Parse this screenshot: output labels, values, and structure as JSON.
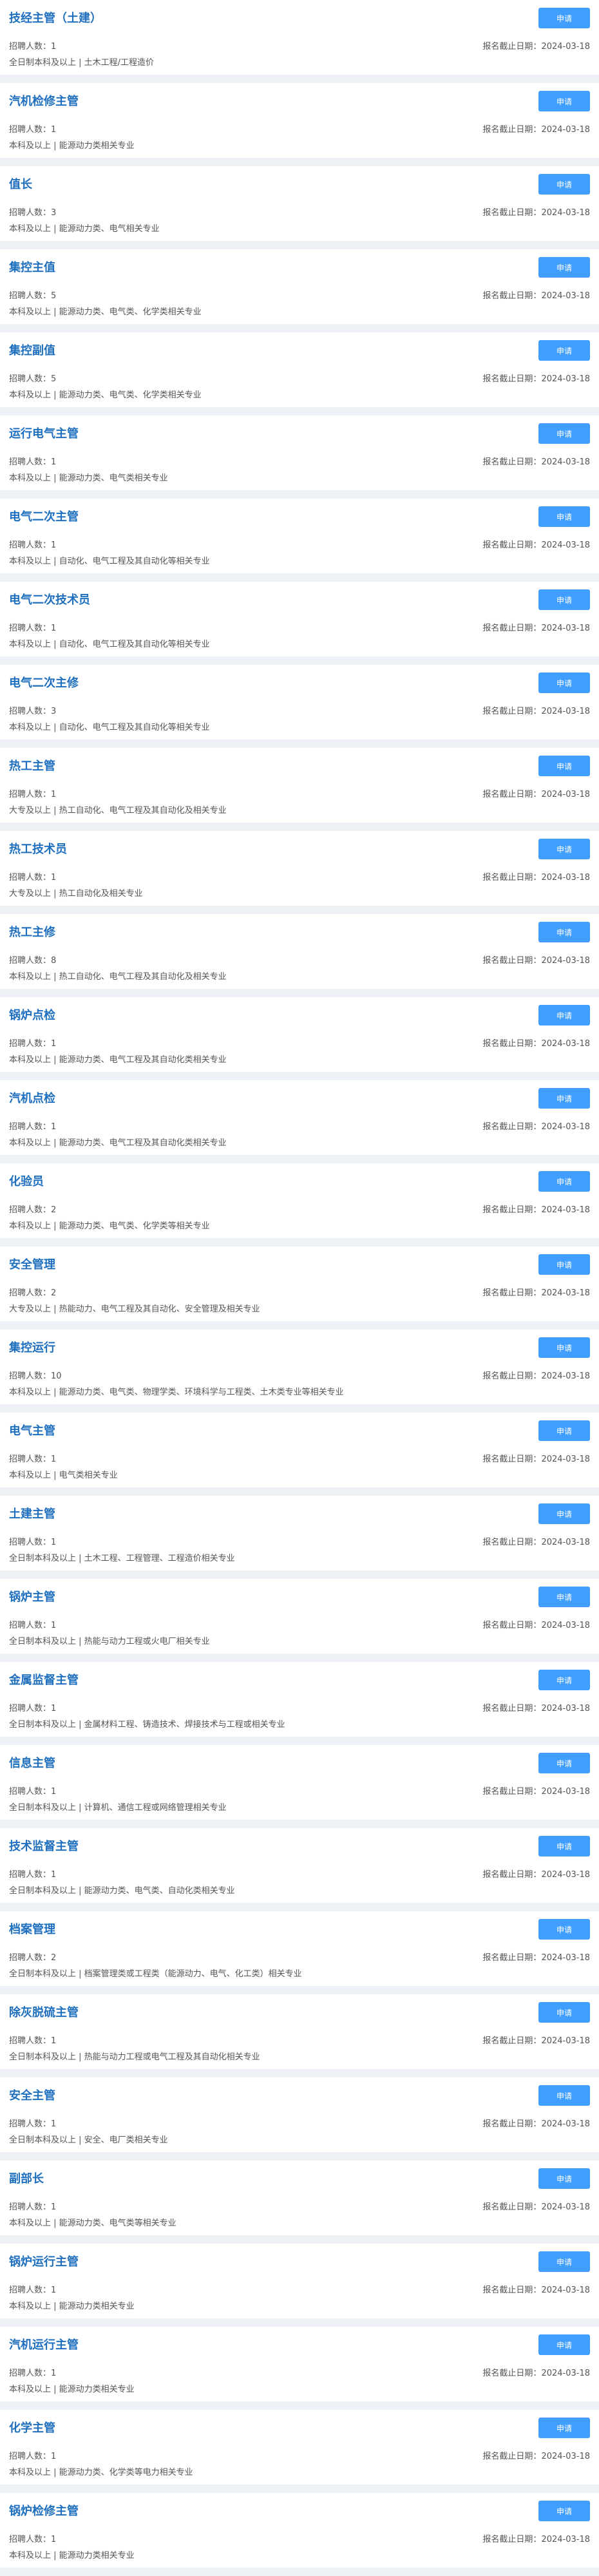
{
  "labels": {
    "apply": "申请",
    "count_prefix": "招聘人数：",
    "deadline_prefix": "报名截止日期："
  },
  "colors": {
    "title": "#1f6fbf",
    "button": "#409eff",
    "background": "#eef1f6"
  },
  "jobs": [
    {
      "title": "技经主管（土建）",
      "count": "1",
      "deadline": "2024-03-18",
      "requirement": "全日制本科及以上 | 土木工程/工程造价"
    },
    {
      "title": "汽机检修主管",
      "count": "1",
      "deadline": "2024-03-18",
      "requirement": "本科及以上 | 能源动力类相关专业"
    },
    {
      "title": "值长",
      "count": "3",
      "deadline": "2024-03-18",
      "requirement": "本科及以上 | 能源动力类、电气相关专业"
    },
    {
      "title": "集控主值",
      "count": "5",
      "deadline": "2024-03-18",
      "requirement": "本科及以上 | 能源动力类、电气类、化学类相关专业"
    },
    {
      "title": "集控副值",
      "count": "5",
      "deadline": "2024-03-18",
      "requirement": "本科及以上 | 能源动力类、电气类、化学类相关专业"
    },
    {
      "title": "运行电气主管",
      "count": "1",
      "deadline": "2024-03-18",
      "requirement": "本科及以上 | 能源动力类、电气类相关专业"
    },
    {
      "title": "电气二次主管",
      "count": "1",
      "deadline": "2024-03-18",
      "requirement": "本科及以上 | 自动化、电气工程及其自动化等相关专业"
    },
    {
      "title": "电气二次技术员",
      "count": "1",
      "deadline": "2024-03-18",
      "requirement": "本科及以上 | 自动化、电气工程及其自动化等相关专业"
    },
    {
      "title": "电气二次主修",
      "count": "3",
      "deadline": "2024-03-18",
      "requirement": "本科及以上 | 自动化、电气工程及其自动化等相关专业"
    },
    {
      "title": "热工主管",
      "count": "1",
      "deadline": "2024-03-18",
      "requirement": "大专及以上 | 热工自动化、电气工程及其自动化及相关专业"
    },
    {
      "title": "热工技术员",
      "count": "1",
      "deadline": "2024-03-18",
      "requirement": "大专及以上 | 热工自动化及相关专业"
    },
    {
      "title": "热工主修",
      "count": "8",
      "deadline": "2024-03-18",
      "requirement": "本科及以上 | 热工自动化、电气工程及其自动化及相关专业"
    },
    {
      "title": "锅炉点检",
      "count": "1",
      "deadline": "2024-03-18",
      "requirement": "本科及以上 | 能源动力类、电气工程及其自动化类相关专业"
    },
    {
      "title": "汽机点检",
      "count": "1",
      "deadline": "2024-03-18",
      "requirement": "本科及以上 | 能源动力类、电气工程及其自动化类相关专业"
    },
    {
      "title": "化验员",
      "count": "2",
      "deadline": "2024-03-18",
      "requirement": "本科及以上 | 能源动力类、电气类、化学类等相关专业"
    },
    {
      "title": "安全管理",
      "count": "2",
      "deadline": "2024-03-18",
      "requirement": "大专及以上 | 热能动力、电气工程及其自动化、安全管理及相关专业"
    },
    {
      "title": "集控运行",
      "count": "10",
      "deadline": "2024-03-18",
      "requirement": "本科及以上 | 能源动力类、电气类、物理学类、环境科学与工程类、土木类专业等相关专业"
    },
    {
      "title": "电气主管",
      "count": "1",
      "deadline": "2024-03-18",
      "requirement": "本科及以上 | 电气类相关专业"
    },
    {
      "title": "土建主管",
      "count": "1",
      "deadline": "2024-03-18",
      "requirement": "全日制本科及以上 | 土木工程、工程管理、工程造价相关专业"
    },
    {
      "title": "锅炉主管",
      "count": "1",
      "deadline": "2024-03-18",
      "requirement": "全日制本科及以上 | 热能与动力工程或火电厂相关专业"
    },
    {
      "title": "金属监督主管",
      "count": "1",
      "deadline": "2024-03-18",
      "requirement": "全日制本科及以上 | 金属材料工程、铸造技术、焊接技术与工程或相关专业"
    },
    {
      "title": "信息主管",
      "count": "1",
      "deadline": "2024-03-18",
      "requirement": "全日制本科及以上 | 计算机、通信工程或网络管理相关专业"
    },
    {
      "title": "技术监督主管",
      "count": "1",
      "deadline": "2024-03-18",
      "requirement": "全日制本科及以上 | 能源动力类、电气类、自动化类相关专业"
    },
    {
      "title": "档案管理",
      "count": "2",
      "deadline": "2024-03-18",
      "requirement": "全日制本科及以上 | 档案管理类或工程类（能源动力、电气、化工类）相关专业"
    },
    {
      "title": "除灰脱硫主管",
      "count": "1",
      "deadline": "2024-03-18",
      "requirement": "全日制本科及以上 | 热能与动力工程或电气工程及其自动化相关专业"
    },
    {
      "title": "安全主管",
      "count": "1",
      "deadline": "2024-03-18",
      "requirement": "全日制本科及以上 | 安全、电厂类相关专业"
    },
    {
      "title": "副部长",
      "count": "1",
      "deadline": "2024-03-18",
      "requirement": "本科及以上 | 能源动力类、电气类等相关专业"
    },
    {
      "title": "锅炉运行主管",
      "count": "1",
      "deadline": "2024-03-18",
      "requirement": "本科及以上 | 能源动力类相关专业"
    },
    {
      "title": "汽机运行主管",
      "count": "1",
      "deadline": "2024-03-18",
      "requirement": "本科及以上 | 能源动力类相关专业"
    },
    {
      "title": "化学主管",
      "count": "1",
      "deadline": "2024-03-18",
      "requirement": "本科及以上 | 能源动力类、化学类等电力相关专业"
    },
    {
      "title": "锅炉检修主管",
      "count": "1",
      "deadline": "2024-03-18",
      "requirement": "本科及以上 | 能源动力类相关专业"
    }
  ]
}
